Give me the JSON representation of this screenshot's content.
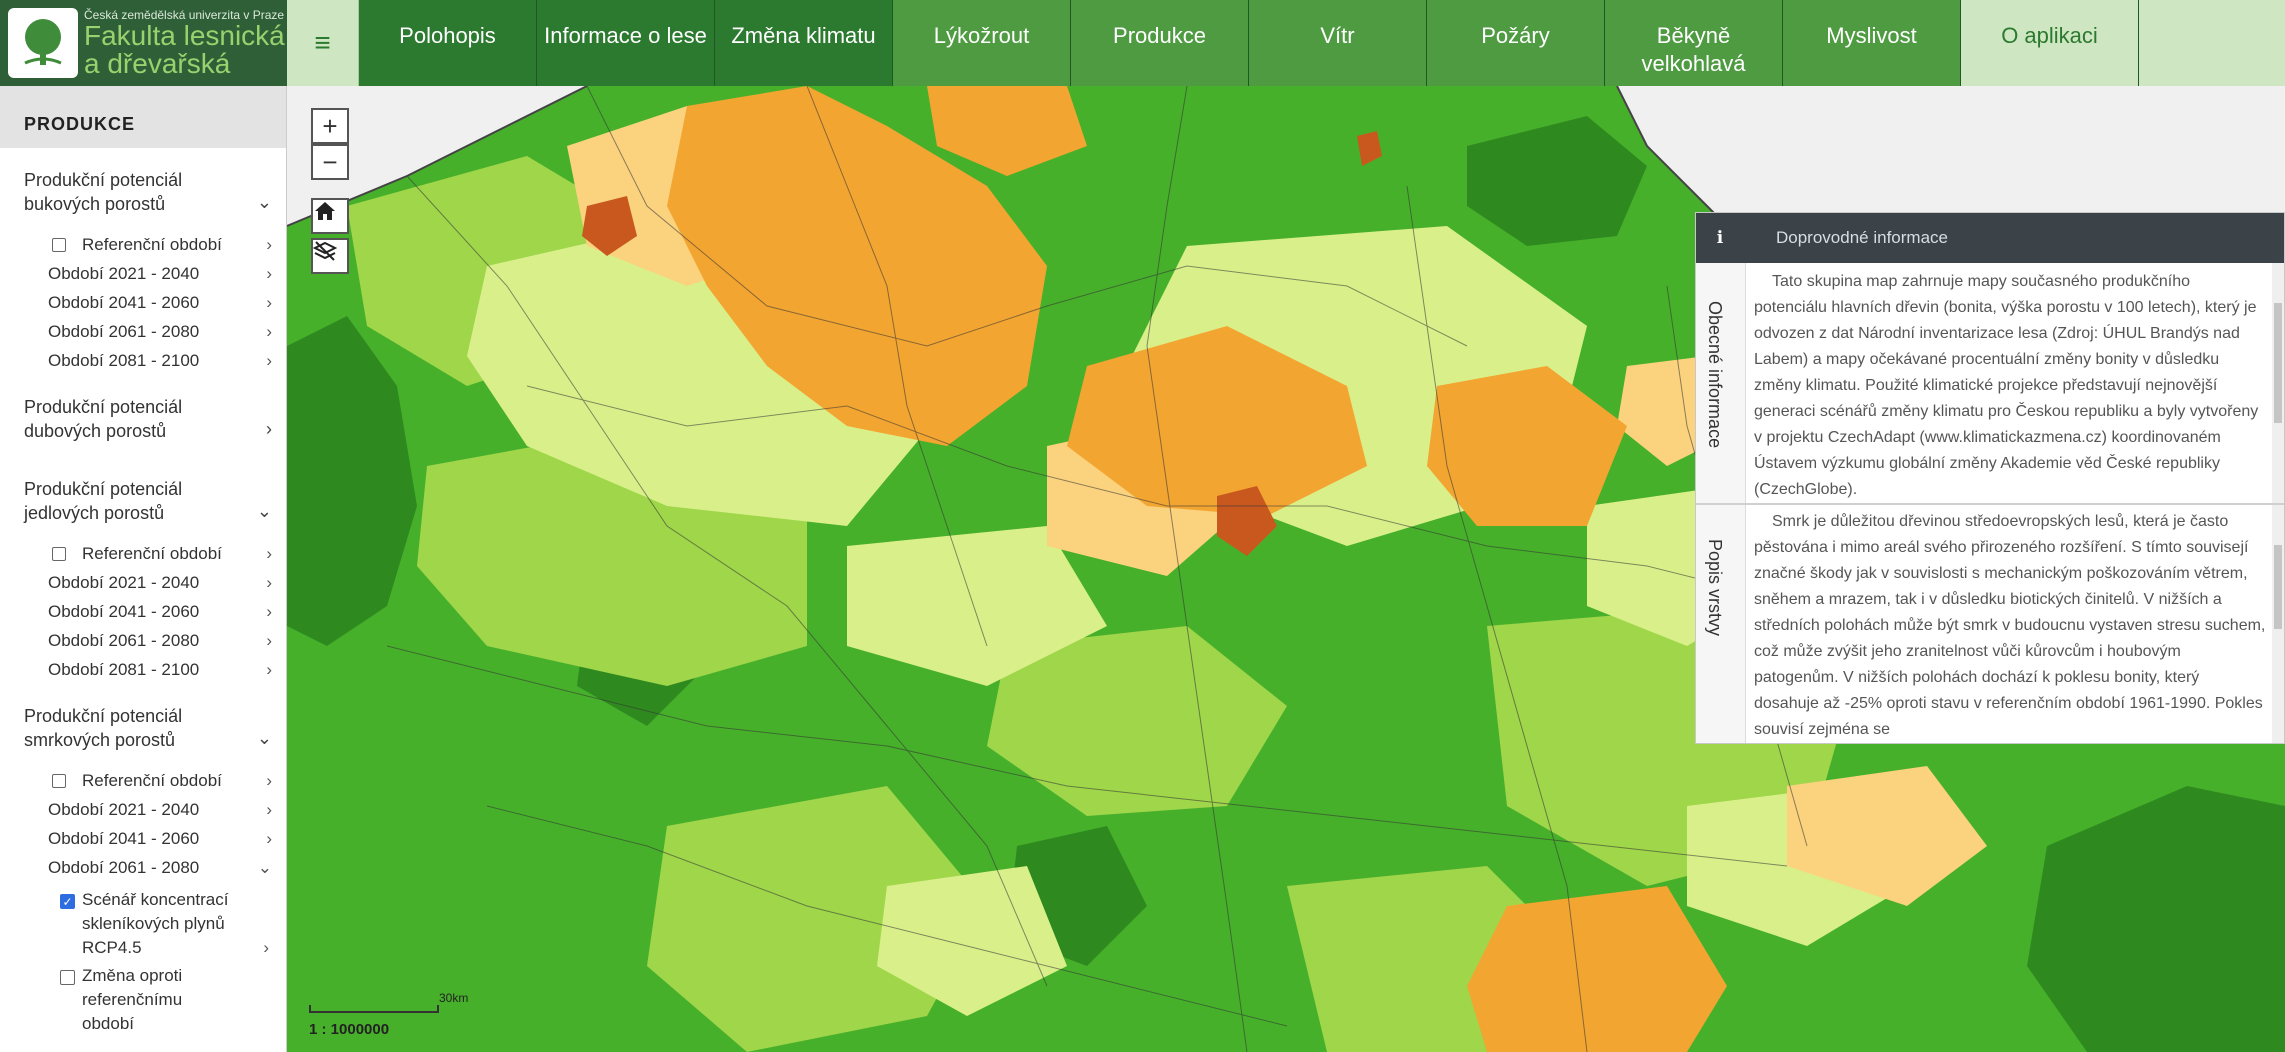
{
  "header": {
    "university": "Česká zemědělská univerzita v Praze",
    "faculty_line1": "Fakulta lesnická",
    "faculty_line2": "a dřevařská",
    "menu_icon": "hamburger-icon",
    "nav": [
      {
        "label": "Polohopis"
      },
      {
        "label": "Informace o lese"
      },
      {
        "label": "Změna klimatu"
      },
      {
        "label": "Lýkožrout"
      },
      {
        "label": "Produkce"
      },
      {
        "label": "Vítr"
      },
      {
        "label": "Požáry"
      },
      {
        "label": "Běkyně velkohlavá"
      },
      {
        "label": "Myslivost"
      },
      {
        "label": "O aplikaci"
      }
    ]
  },
  "sidebar": {
    "title": "PRODUKCE",
    "groups": [
      {
        "title": "Produkční potenciál bukových porostů",
        "items": [
          "Referenční období",
          "Období 2021 - 2040",
          "Období 2041 - 2060",
          "Období 2061 - 2080",
          "Období 2081 - 2100"
        ]
      },
      {
        "title": "Produkční potenciál dubových porostů",
        "items": []
      },
      {
        "title": "Produkční potenciál jedlových porostů",
        "items": [
          "Referenční období",
          "Období 2021 - 2040",
          "Období 2041 - 2060",
          "Období 2061 - 2080",
          "Období 2081 - 2100"
        ]
      },
      {
        "title": "Produkční potenciál smrkových porostů",
        "items": [
          "Referenční období",
          "Období 2021 - 2040",
          "Období 2041 - 2060",
          "Období 2061 - 2080"
        ],
        "subitems": [
          {
            "label": "Scénář koncentrací skleníkových plynů RCP4.5",
            "checked": true
          },
          {
            "label": "Změna oproti referenčnímu období",
            "checked": false
          }
        ]
      }
    ]
  },
  "map": {
    "zoom_in": "+",
    "zoom_out": "−",
    "scale_label": "30km",
    "scale_ratio": "1 : 1000000"
  },
  "info_panel": {
    "title": "Doprovodné informace",
    "tab_general": "Obecné informace",
    "tab_layer": "Popis vrstvy",
    "general_text": "Tato skupina map zahrnuje mapy současného produkčního potenciálu hlavních dřevin (bonita, výška porostu v 100 letech), který je odvozen z dat Národní inventarizace lesa (Zdroj: ÚHUL Brandýs nad Labem) a mapy očekávané procentuální změny bonity v důsledku změny klimatu. Použité klimatické projekce představují nejnovější generaci scénářů změny klimatu pro Českou republiku a byly vytvořeny v projektu CzechAdapt (www.klimatickazmena.cz) koordinovaném Ústavem výzkumu globální změny Akademie věd České republiky (CzechGlobe).",
    "layer_text": "Smrk je důležitou dřevinou středoevropských lesů, která je často pěstována i mimo areál svého přirozeného rozšíření. S tímto souvisejí značné škody jak v souvislosti s mechanickým poškozováním větrem, sněhem a mrazem, tak i v důsledku biotických činitelů. V nižších a středních polohách může být smrk v budoucnu vystaven stresu suchem, což může zvýšit jeho zranitelnost vůči kůrovcům i houbovým patogenům. V nižších polohách dochází k poklesu bonity, který dosahuje až -25% oproti stavu v referenčním období 1961-1990. Pokles souvisí zejména se"
  },
  "colors": {
    "dark_green": "#2b7a2f",
    "mid_green": "#4f9b42",
    "light_green": "#cfe6c3",
    "map_dark": "#2e8a1f",
    "map_green": "#47b02b",
    "map_lime": "#9fd64a",
    "map_pale": "#d9f08a",
    "map_tan": "#fbd27e",
    "map_orange": "#f3a531",
    "map_red": "#c8581e"
  }
}
